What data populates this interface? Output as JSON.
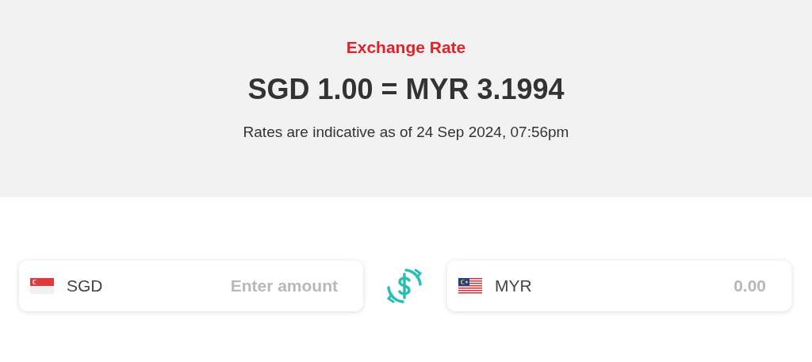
{
  "header": {
    "title": "Exchange Rate",
    "rate": "SGD 1.00 = MYR 3.1994",
    "note": "Rates are indicative as of 24 Sep 2024, 07:56pm"
  },
  "converter": {
    "from": {
      "currency": "SGD",
      "placeholder": "Enter amount"
    },
    "to": {
      "currency": "MYR",
      "value": "0.00"
    }
  }
}
